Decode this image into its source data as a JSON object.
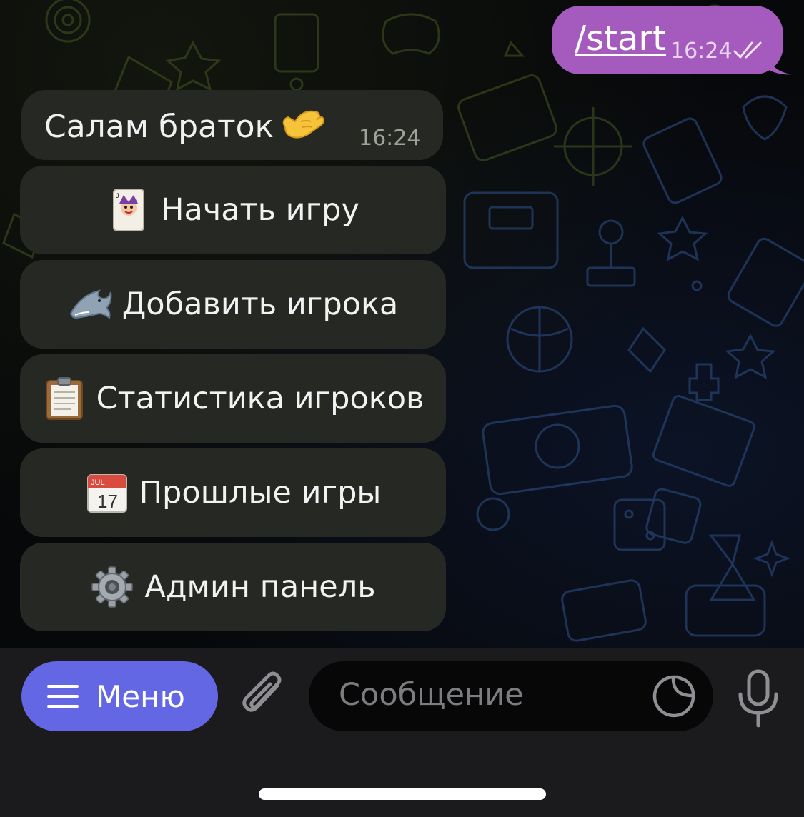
{
  "outgoing": {
    "text": "/start",
    "time": "16:24",
    "bubble_color": "#a55bbd"
  },
  "incoming": {
    "text": "Салам браток",
    "emoji": "call-me-hand",
    "time": "16:24"
  },
  "keyboard": {
    "buttons": [
      {
        "emoji": "joker-card",
        "label": "Начать игру"
      },
      {
        "emoji": "shark",
        "label": "Добавить игрока"
      },
      {
        "emoji": "clipboard",
        "label": "Статистика игроков"
      },
      {
        "emoji": "calendar",
        "label": "Прошлые игры",
        "calendar_month": "JUL",
        "calendar_day": "17"
      },
      {
        "emoji": "gear",
        "label": "Админ панель"
      }
    ]
  },
  "composer": {
    "menu_label": "Меню",
    "menu_color": "#6467e4",
    "placeholder": "Сообщение",
    "attach_icon": "paperclip-icon",
    "sticker_icon": "sticker-icon",
    "mic_icon": "microphone-icon"
  }
}
